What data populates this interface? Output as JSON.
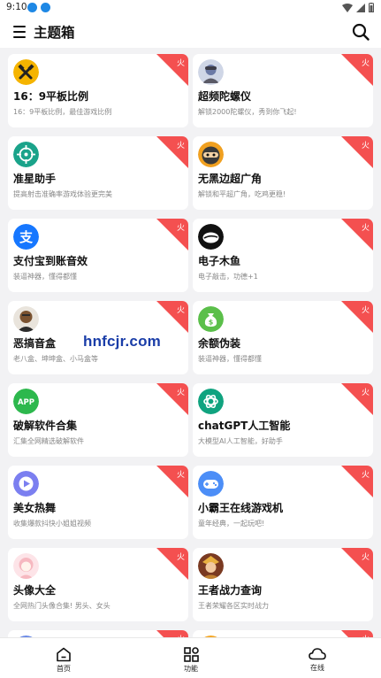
{
  "status_bar": {
    "time": "9:10"
  },
  "app_bar": {
    "title": "主题箱"
  },
  "badge_text": "火",
  "cards": [
    {
      "title": "16：9平板比例",
      "desc": "16：9平板比例，最佳游戏比例",
      "icon": "hammer-icon",
      "color": "#f5b400"
    },
    {
      "title": "超频陀螺仪",
      "desc": "解锁2000陀螺仪，秀到你飞起!",
      "icon": "pubg-avatar-icon",
      "color": "#6b7aa6"
    },
    {
      "title": "准星助手",
      "desc": "提高射击准确率游戏体验更完美",
      "icon": "crosshair-icon",
      "color": "#1aa38a"
    },
    {
      "title": "无黑边超广角",
      "desc": "解锁和平超广角，吃鸡更稳!",
      "icon": "ninja-icon",
      "color": "#f0a020"
    },
    {
      "title": "支付宝到账音效",
      "desc": "装逼神器，懂得都懂",
      "icon": "alipay-icon",
      "color": "#1677ff"
    },
    {
      "title": "电子木鱼",
      "desc": "电子敲击，功德+1",
      "icon": "wooden-fish-icon",
      "color": "#111111"
    },
    {
      "title": "恶搞音盒",
      "desc": "老八盒、坤坤盒、小马盒等",
      "icon": "prank-avatar-icon",
      "color": "#7a5230"
    },
    {
      "title": "余额伪装",
      "desc": "装逼神器，懂得都懂",
      "icon": "money-bag-icon",
      "color": "#5bbf4a"
    },
    {
      "title": "破解软件合集",
      "desc": "汇集全网精选破解软件",
      "icon": "app-icon",
      "color": "#2db84d"
    },
    {
      "title": "chatGPT人工智能",
      "desc": "大模型AI人工智能，好助手",
      "icon": "chatgpt-icon",
      "color": "#10a37f"
    },
    {
      "title": "美女热舞",
      "desc": "收集爆款抖快小姐姐视频",
      "icon": "play-icon",
      "color": "#7b7ff0"
    },
    {
      "title": "小霸王在线游戏机",
      "desc": "童年经典，一起玩吧!",
      "icon": "gamepad-icon",
      "color": "#4c8ef7"
    },
    {
      "title": "头像大全",
      "desc": "全网热门头像合集! 男头、女头",
      "icon": "girl-avatar-icon",
      "color": "#f6b8c0"
    },
    {
      "title": "王者战力查询",
      "desc": "王者荣耀各区实时战力",
      "icon": "hero-avatar-icon",
      "color": "#c08030"
    },
    {
      "title": "",
      "desc": "",
      "icon": "partial-icon",
      "color": "#6b8ae6"
    },
    {
      "title": "",
      "desc": "",
      "icon": "partial-icon",
      "color": "#f4a623"
    }
  ],
  "watermark": "hnfcjr.com",
  "bottom_nav": [
    {
      "label": "首页",
      "icon": "home-icon"
    },
    {
      "label": "功能",
      "icon": "grid-icon"
    },
    {
      "label": "在线",
      "icon": "cloud-icon"
    }
  ]
}
